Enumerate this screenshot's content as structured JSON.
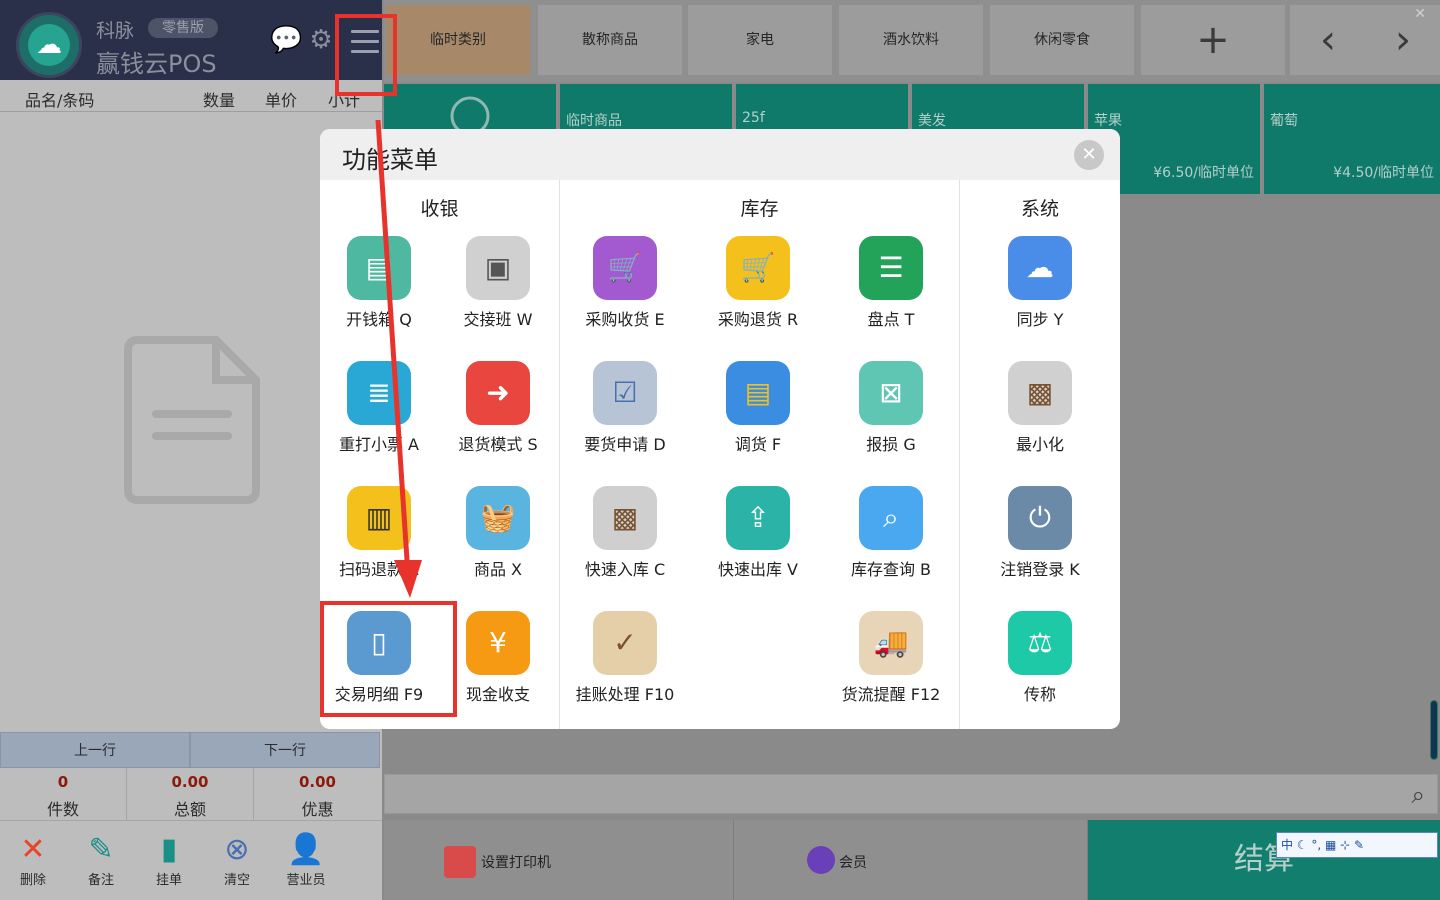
{
  "header": {
    "brand_top": "科脉",
    "edition": "零售版",
    "brand_main": "赢钱云POS"
  },
  "columns": [
    "品名/条码",
    "数量",
    "单价",
    "小计"
  ],
  "nav": {
    "prev": "上一行",
    "next": "下一行"
  },
  "totals": [
    {
      "value": "0",
      "label": "件数"
    },
    {
      "value": "0.00",
      "label": "总额"
    },
    {
      "value": "0.00",
      "label": "优惠"
    }
  ],
  "actions": [
    "删除",
    "备注",
    "挂单",
    "清空",
    "营业员"
  ],
  "categories": [
    "临时类别",
    "散称商品",
    "家电",
    "酒水饮料",
    "休闲零食"
  ],
  "products": [
    {
      "name": "临时商品",
      "price": ""
    },
    {
      "name": "25f",
      "price": ""
    },
    {
      "name": "美发",
      "price": ""
    },
    {
      "name": "苹果",
      "price": "¥6.50/临时单位"
    },
    {
      "name": "葡萄",
      "price": "¥4.50/临时单位"
    }
  ],
  "footer": {
    "printer": "设置打印机",
    "member": "会员",
    "checkout": "结算",
    "ime": "中"
  },
  "modal": {
    "title": "功能菜单",
    "sections": {
      "cashier": "收银",
      "stock": "库存",
      "system": "系统"
    },
    "cashier_items": [
      "开钱箱 Q",
      "交接班 W",
      "重打小票 A",
      "退货模式 S",
      "扫码退款 Z",
      "商品 X",
      "交易明细 F9",
      "现金收支"
    ],
    "stock_items": [
      "采购收货 E",
      "采购退货 R",
      "盘点 T",
      "要货申请 D",
      "调货 F",
      "报损 G",
      "快速入库 C",
      "快速出库 V",
      "库存查询 B",
      "挂账处理 F10",
      "货流提醒 F12"
    ],
    "system_items": [
      "同步 Y",
      "最小化",
      "注销登录 K",
      "传称"
    ]
  }
}
